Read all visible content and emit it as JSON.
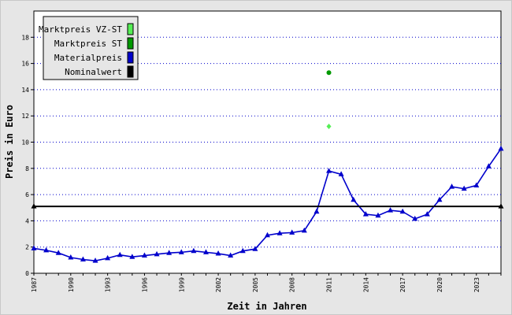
{
  "chart_data": {
    "type": "line",
    "xlabel": "Zeit in Jahren",
    "ylabel": "Preis in Euro",
    "xlim": [
      1987,
      2025
    ],
    "ylim": [
      0,
      20
    ],
    "x_ticks": [
      1987,
      1990,
      1993,
      1996,
      1999,
      2002,
      2005,
      2008,
      2011,
      2014,
      2017,
      2020,
      2023
    ],
    "y_ticks": [
      0,
      2,
      4,
      6,
      8,
      10,
      12,
      14,
      16,
      18
    ],
    "grid": "horizontal-dotted",
    "legend_position": "top-left",
    "series": [
      {
        "name": "Marktpreis VZ-ST",
        "color": "#55ee55",
        "marker": "diamond",
        "x": [
          2011
        ],
        "y": [
          11.2
        ]
      },
      {
        "name": "Marktpreis ST",
        "color": "#009900",
        "marker": "circle",
        "x": [
          2011
        ],
        "y": [
          15.3
        ]
      },
      {
        "name": "Materialpreis",
        "color": "#0000cc",
        "marker": "triangle",
        "x": [
          1987,
          1988,
          1989,
          1990,
          1991,
          1992,
          1993,
          1994,
          1995,
          1996,
          1997,
          1998,
          1999,
          2000,
          2001,
          2002,
          2003,
          2004,
          2005,
          2006,
          2007,
          2008,
          2009,
          2010,
          2011,
          2012,
          2013,
          2014,
          2015,
          2016,
          2017,
          2018,
          2019,
          2020,
          2021,
          2022,
          2023,
          2024,
          2025
        ],
        "y": [
          1.9,
          1.75,
          1.55,
          1.2,
          1.05,
          0.95,
          1.15,
          1.4,
          1.25,
          1.35,
          1.45,
          1.55,
          1.6,
          1.7,
          1.6,
          1.5,
          1.35,
          1.7,
          1.85,
          2.9,
          3.05,
          3.1,
          3.25,
          4.7,
          7.8,
          7.55,
          5.6,
          4.5,
          4.4,
          4.8,
          4.7,
          4.15,
          4.5,
          5.6,
          6.6,
          6.45,
          6.7,
          8.15,
          9.5
        ]
      },
      {
        "name": "Nominalwert",
        "color": "#000000",
        "marker": "triangle",
        "x": [
          1987,
          2025
        ],
        "y": [
          5.1,
          5.1
        ]
      }
    ]
  }
}
